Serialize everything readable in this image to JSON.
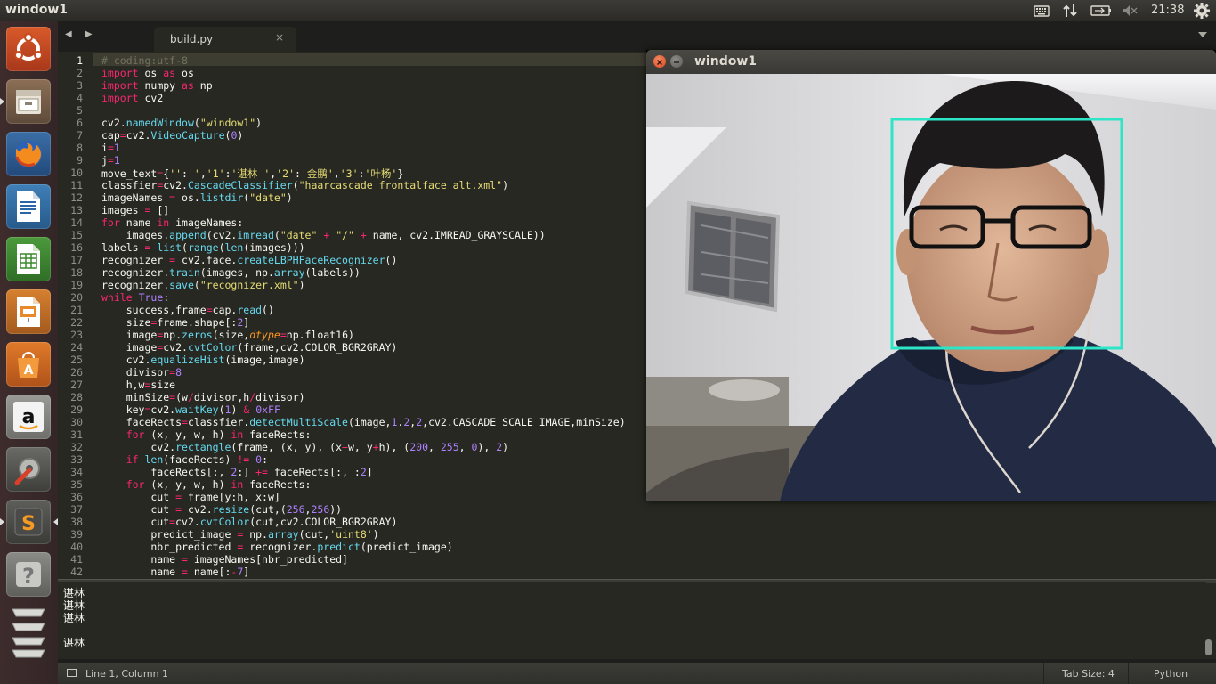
{
  "topbar": {
    "title": "window1",
    "time": "21:38",
    "icons": [
      "keyboard-icon",
      "network-icon",
      "battery-icon",
      "volume-muted-icon",
      "settings-gear-icon"
    ]
  },
  "launcher": {
    "items": [
      "ubuntu-dash",
      "files",
      "firefox",
      "libreoffice-writer",
      "libreoffice-calc",
      "libreoffice-impress",
      "ubuntu-software-center",
      "amazon",
      "system-settings",
      "sublime-text",
      "help",
      "workspaces-switcher"
    ]
  },
  "editor": {
    "tab_name": "build.py",
    "tab_close": "×",
    "nav_arrows": "◀ ▶",
    "line_numbers": [
      "1",
      "2",
      "3",
      "4",
      "5",
      "6",
      "7",
      "8",
      "9",
      "10",
      "11",
      "12",
      "13",
      "14",
      "15",
      "16",
      "17",
      "18",
      "19",
      "20",
      "21",
      "22",
      "23",
      "24",
      "25",
      "26",
      "27",
      "28",
      "29",
      "30",
      "31",
      "32",
      "33",
      "34",
      "35",
      "36",
      "37",
      "38",
      "39",
      "40",
      "41",
      "42"
    ],
    "code_lines": [
      "# coding:utf-8",
      "import os as os",
      "import numpy as np",
      "import cv2",
      "",
      "cv2.namedWindow(\"window1\")",
      "cap=cv2.VideoCapture(0)",
      "i=1",
      "j=1",
      "move_text={'':'','1':'谌林 ','2':'金鹏','3':'叶杨'}",
      "classfier=cv2.CascadeClassifier(\"haarcascade_frontalface_alt.xml\")",
      "imageNames = os.listdir(\"date\")",
      "images = []",
      "for name in imageNames:",
      "    images.append(cv2.imread(\"date\" + \"/\" + name, cv2.IMREAD_GRAYSCALE))",
      "labels = list(range(len(images)))",
      "recognizer = cv2.face.createLBPHFaceRecognizer()",
      "recognizer.train(images, np.array(labels))",
      "recognizer.save(\"recognizer.xml\")",
      "while True:",
      "    success,frame=cap.read()",
      "    size=frame.shape[:2]",
      "    image=np.zeros(size,dtype=np.float16)",
      "    image=cv2.cvtColor(frame,cv2.COLOR_BGR2GRAY)",
      "    cv2.equalizeHist(image,image)",
      "    divisor=8",
      "    h,w=size",
      "    minSize=(w/divisor,h/divisor)",
      "    key=cv2.waitKey(1) & 0xFF",
      "    faceRects=classfier.detectMultiScale(image,1.2,2,cv2.CASCADE_SCALE_IMAGE,minSize)",
      "    for (x, y, w, h) in faceRects:",
      "        cv2.rectangle(frame, (x, y), (x+w, y+h), (200, 255, 0), 2)",
      "    if len(faceRects) != 0:",
      "        faceRects[:, 2:] += faceRects[:, :2]",
      "    for (x, y, w, h) in faceRects:",
      "        cut = frame[y:h, x:w]",
      "        cut = cv2.resize(cut,(256,256))",
      "        cut=cv2.cvtColor(cut,cv2.COLOR_BGR2GRAY)",
      "        predict_image = np.array(cut,'uint8')",
      "        nbr_predicted = recognizer.predict(predict_image)",
      "        name = imageNames[nbr_predicted]",
      "        name = name[:-7]"
    ],
    "console_lines": [
      "谌林",
      "谌林",
      "谌林",
      "",
      "谌林"
    ],
    "status": {
      "position": "Line 1, Column 1",
      "tab_size": "Tab Size: 4",
      "syntax": "Python"
    }
  },
  "camera_window": {
    "title": "window1",
    "detection_color": "#2de6c8"
  },
  "colors": {
    "keyword": "#f92672",
    "string": "#e6db74",
    "function": "#66d9ef",
    "number": "#ae81ff",
    "comment": "#75715e",
    "background": "#272822"
  }
}
